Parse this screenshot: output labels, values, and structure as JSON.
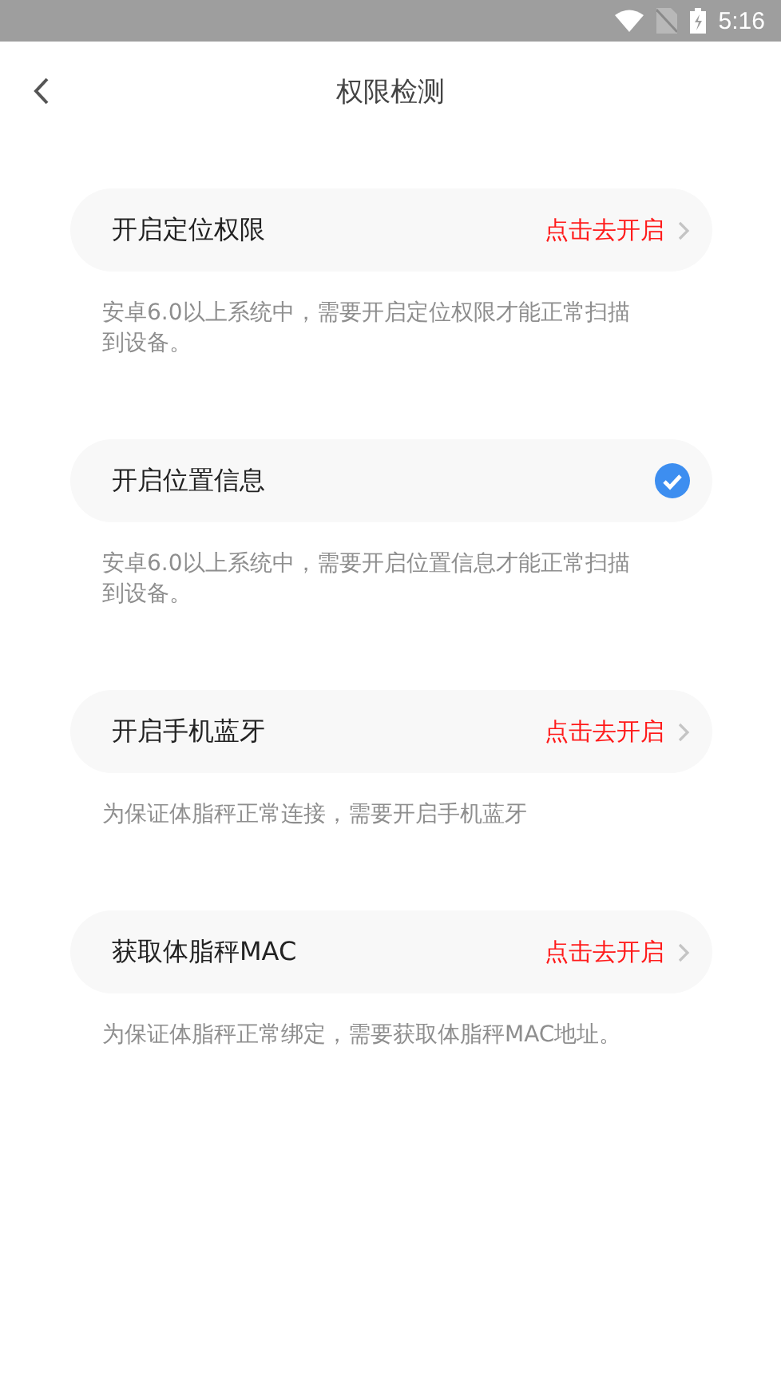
{
  "status_bar": {
    "time": "5:16"
  },
  "header": {
    "title": "权限检测"
  },
  "items": [
    {
      "label": "开启定位权限",
      "granted": false,
      "action": "点击去开启",
      "description": "安卓6.0以上系统中，需要开启定位权限才能正常扫描到设备。"
    },
    {
      "label": "开启位置信息",
      "granted": true,
      "description": "安卓6.0以上系统中，需要开启位置信息才能正常扫描到设备。"
    },
    {
      "label": "开启手机蓝牙",
      "granted": false,
      "action": "点击去开启",
      "description": "为保证体脂秤正常连接，需要开启手机蓝牙"
    },
    {
      "label": "获取体脂秤MAC",
      "granted": false,
      "action": "点击去开启",
      "description": "为保证体脂秤正常绑定，需要获取体脂秤MAC地址。"
    }
  ]
}
